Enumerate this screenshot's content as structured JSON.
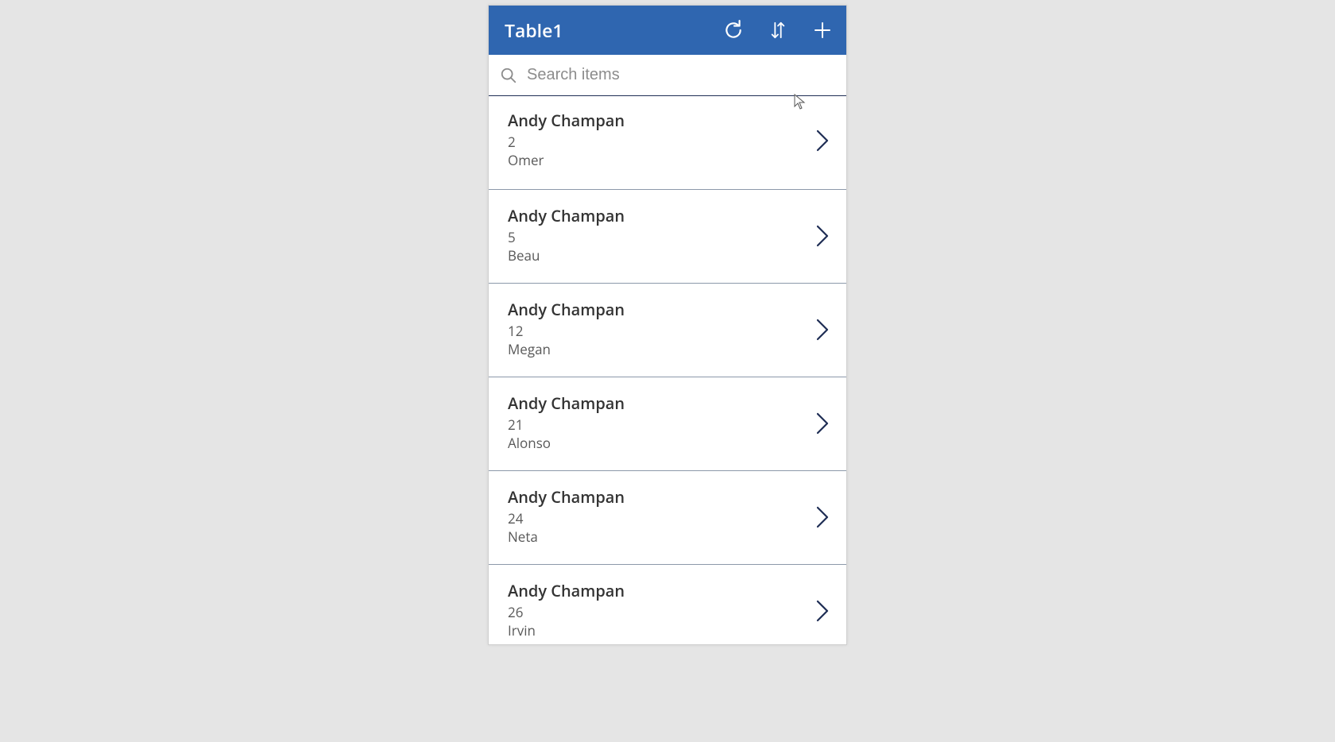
{
  "header": {
    "title": "Table1"
  },
  "search": {
    "placeholder": "Search items",
    "value": ""
  },
  "items": [
    {
      "title": "Andy Champan",
      "line2": "2",
      "line3": "Omer"
    },
    {
      "title": "Andy Champan",
      "line2": "5",
      "line3": "Beau"
    },
    {
      "title": "Andy Champan",
      "line2": "12",
      "line3": "Megan"
    },
    {
      "title": "Andy Champan",
      "line2": "21",
      "line3": "Alonso"
    },
    {
      "title": "Andy Champan",
      "line2": "24",
      "line3": "Neta"
    },
    {
      "title": "Andy Champan",
      "line2": "26",
      "line3": "Irvin"
    }
  ]
}
